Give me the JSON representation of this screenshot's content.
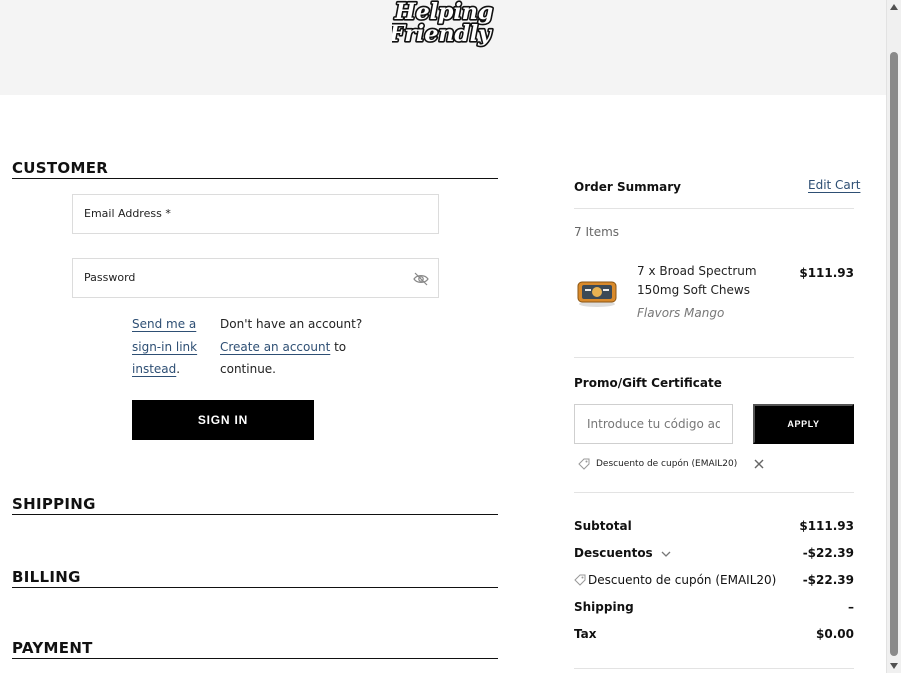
{
  "brand": {
    "logo_text_line1": "Helping",
    "logo_text_line2": "Friendly"
  },
  "checkout": {
    "customer": {
      "title": "CUSTOMER",
      "email_label": "Email Address *",
      "password_label": "Password",
      "signin_link_parts": [
        "Send me a",
        "sign-in link",
        "instead"
      ],
      "signin_link_suffix": ".",
      "no_account": "Don't have an account?",
      "create_account_link": "Create an account",
      "create_account_suffix": " to",
      "continue": "continue.",
      "signin_button": "SIGN IN"
    },
    "shipping_title": "SHIPPING",
    "billing_title": "BILLING",
    "payment_title": "PAYMENT"
  },
  "summary": {
    "title": "Order Summary",
    "edit_cart": "Edit Cart",
    "items_count": "7 Items",
    "product": {
      "name": "7 x Broad Spectrum 150mg Soft Chews",
      "option": "Flavors Mango",
      "price": "$111.93"
    },
    "promo": {
      "title": "Promo/Gift Certificate",
      "placeholder": "Introduce tu código aquí",
      "apply_button": "APPLY",
      "applied_coupon": "Descuento de cupón (EMAIL20)"
    },
    "totals": {
      "subtotal_label": "Subtotal",
      "subtotal_value": "$111.93",
      "discounts_label": "Descuentos",
      "discounts_value": "-$22.39",
      "coupon_label": "Descuento de cupón (EMAIL20)",
      "coupon_value": "-$22.39",
      "shipping_label": "Shipping",
      "shipping_value": "–",
      "tax_label": "Tax",
      "tax_value": "$0.00"
    }
  },
  "colors": {
    "link": "#2e4f74",
    "button_bg": "#000000",
    "header_bg": "#f4f4f4"
  }
}
